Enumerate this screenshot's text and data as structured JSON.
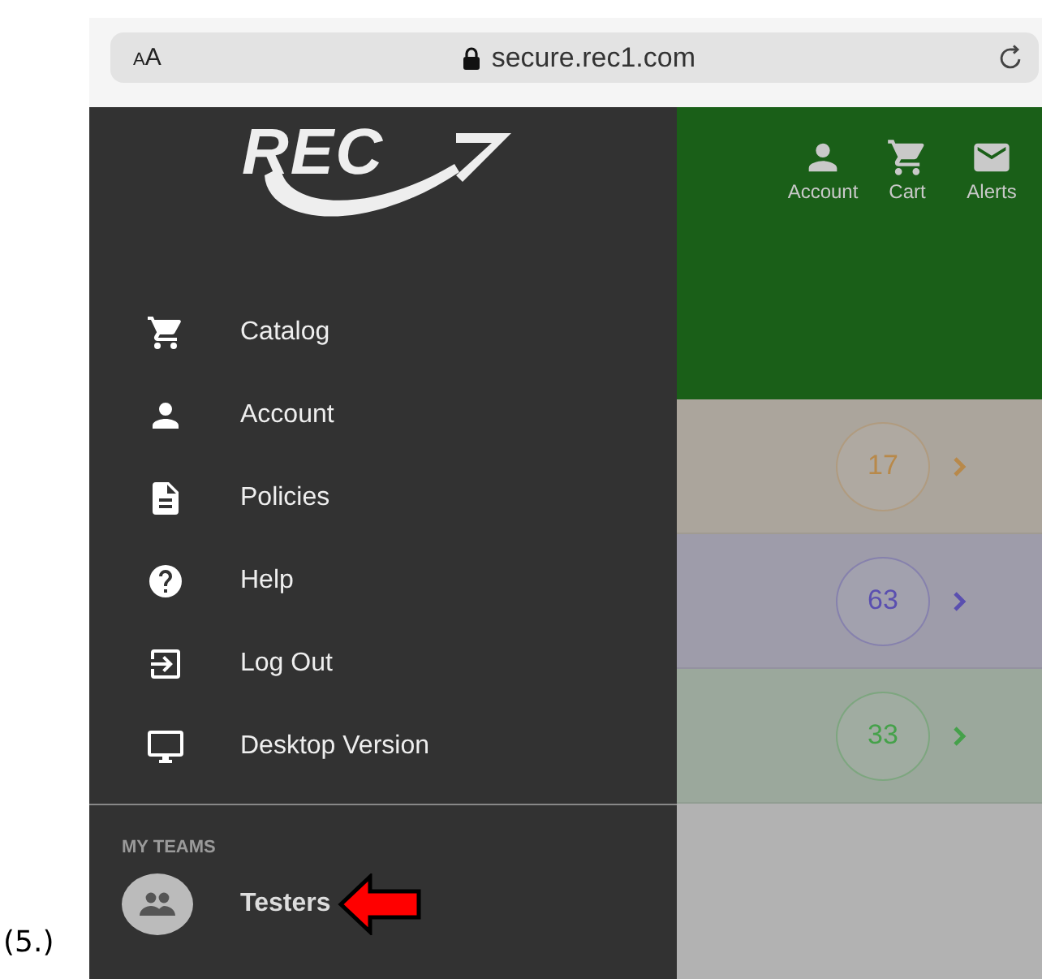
{
  "browser": {
    "text_size_button": "AA",
    "url": "secure.rec1.com"
  },
  "header": {
    "logo": "REC",
    "nav": [
      {
        "label": "Account",
        "kind": "account"
      },
      {
        "label": "Cart",
        "kind": "cart"
      },
      {
        "label": "Alerts",
        "kind": "alerts"
      }
    ]
  },
  "drawer": {
    "items": [
      {
        "label": "Catalog",
        "kind": "cart"
      },
      {
        "label": "Account",
        "kind": "account"
      },
      {
        "label": "Policies",
        "kind": "document"
      },
      {
        "label": "Help",
        "kind": "help"
      },
      {
        "label": "Log Out",
        "kind": "logout"
      },
      {
        "label": "Desktop Version",
        "kind": "desktop"
      }
    ],
    "section_title": "MY TEAMS",
    "teams": [
      {
        "label": "Testers"
      }
    ]
  },
  "rows": [
    {
      "count": "17",
      "color": "#b8894a"
    },
    {
      "count": "63",
      "color": "#5a4fb0"
    },
    {
      "count": "33",
      "color": "#45a14a"
    }
  ],
  "caption": "(5.)"
}
